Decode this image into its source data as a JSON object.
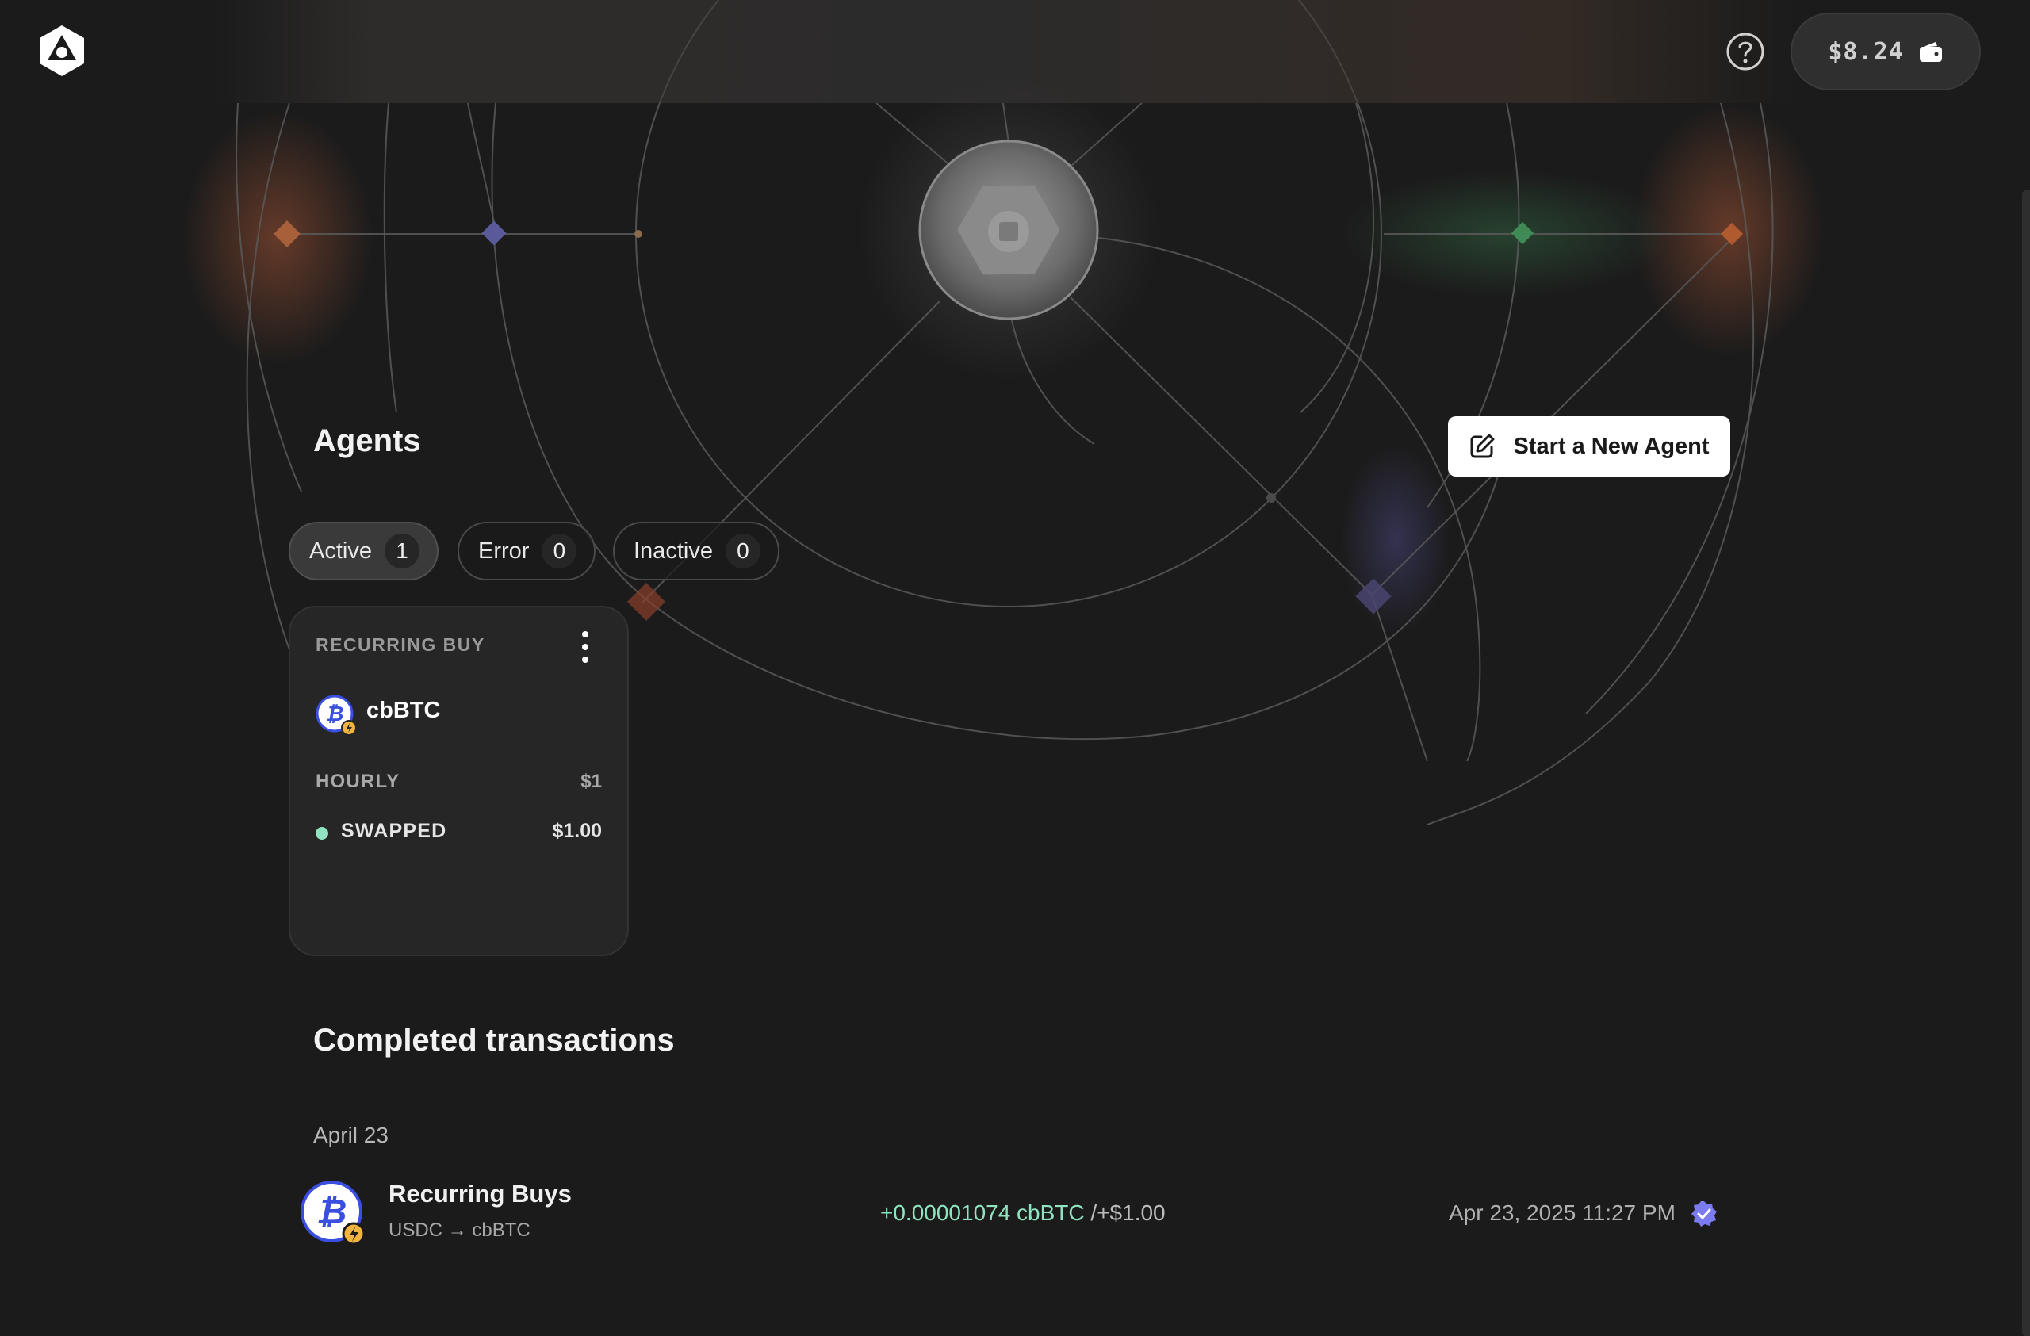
{
  "header": {
    "logo": "app-logo",
    "help_icon": "question-circle-icon",
    "wallet_balance": "$8.24",
    "wallet_icon": "wallet-icon"
  },
  "agents": {
    "title": "Agents",
    "new_agent_label": "Start a New Agent",
    "new_agent_icon": "edit-square-icon",
    "tabs": [
      {
        "label": "Active",
        "count": "1"
      },
      {
        "label": "Error",
        "count": "0"
      },
      {
        "label": "Inactive",
        "count": "0"
      }
    ],
    "cards": [
      {
        "type": "RECURRING BUY",
        "token": "cbBTC",
        "token_icon": "bitcoin-icon",
        "frequency": "HOURLY",
        "amount": "$1",
        "status": "SWAPPED",
        "status_amount": "$1.00",
        "status_color": "#8fe3c0"
      }
    ]
  },
  "transactions": {
    "title": "Completed transactions",
    "groups": [
      {
        "date": "April 23",
        "items": [
          {
            "name": "Recurring Buys",
            "pair": "USDC → cbBTC",
            "amount_token": "+0.00001074 cbBTC",
            "amount_usd": " /+$1.00",
            "time": "Apr 23, 2025 11:27 PM",
            "verified_icon": "verified-badge-icon"
          }
        ]
      }
    ]
  },
  "colors": {
    "background": "#1b1b1b",
    "card": "#262626",
    "positive": "#8fe3c0",
    "verified": "#7b7bf0",
    "bitcoin_blue": "#3a4fe0"
  }
}
